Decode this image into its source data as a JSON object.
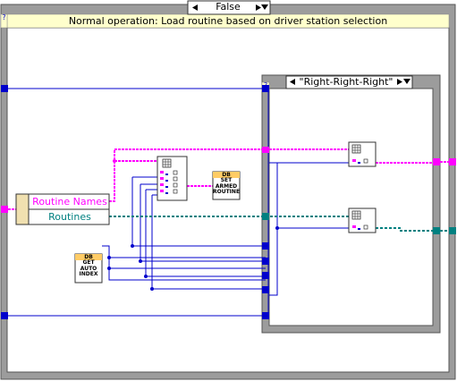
{
  "outer_case": {
    "selector_label": "False",
    "condition_label": "Normal operation: Load routine based on driver station selection",
    "help_marker": "?"
  },
  "inner_case": {
    "selector_label": "\"Right-Right-Right\"",
    "help_marker": "?"
  },
  "unbundle": {
    "field_1": "Routine Names",
    "field_2": "Routines"
  },
  "subvis": {
    "set_armed_routine": "DB\nSET\nARMED\nROUTINE",
    "get_auto_index": "DB\nGET\nAUTO\nINDEX"
  },
  "colors": {
    "outer_border": "#9c9c9c",
    "condition_bar": "#ffffcc",
    "string_wire": "#ff00ff",
    "cluster_wire": "#008080",
    "numeric_wire": "#0000cc",
    "subvi_header": "#ffcc66"
  }
}
